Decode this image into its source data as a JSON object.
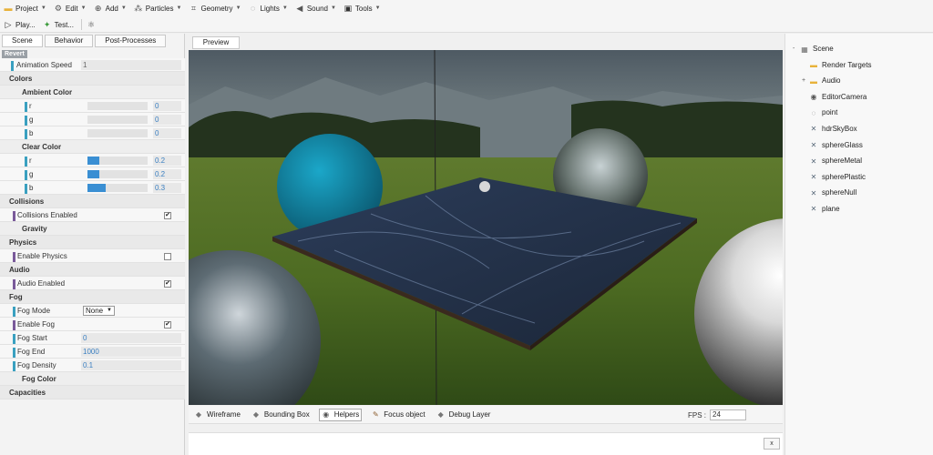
{
  "menu": {
    "row1": [
      {
        "name": "project",
        "label": "Project",
        "icon": "folder-icon",
        "caret": true
      },
      {
        "name": "edit",
        "label": "Edit",
        "icon": "gear-icon",
        "caret": true
      },
      {
        "name": "add",
        "label": "Add",
        "icon": "plus-circle-icon",
        "caret": true
      },
      {
        "name": "particles",
        "label": "Particles",
        "icon": "particles-icon",
        "caret": true
      },
      {
        "name": "geometry",
        "label": "Geometry",
        "icon": "geometry-icon",
        "caret": true
      },
      {
        "name": "lights",
        "label": "Lights",
        "icon": "bulb-icon",
        "caret": true
      },
      {
        "name": "sound",
        "label": "Sound",
        "icon": "speaker-icon",
        "caret": true
      },
      {
        "name": "tools",
        "label": "Tools",
        "icon": "clapper-icon",
        "caret": true
      }
    ],
    "row2": [
      {
        "name": "play",
        "label": "Play...",
        "icon": "play-icon"
      },
      {
        "name": "test",
        "label": "Test...",
        "icon": "wand-icon"
      },
      {
        "name": "logo",
        "label": "",
        "icon": "babylon-logo-icon"
      }
    ]
  },
  "left_tabs": [
    {
      "label": "Scene",
      "active": true
    },
    {
      "label": "Behavior",
      "active": false
    },
    {
      "label": "Post-Processes",
      "active": false
    }
  ],
  "props": {
    "revert": "Revert",
    "animation_speed": {
      "label": "Animation Speed",
      "value": "1"
    },
    "colors": "Colors",
    "ambient_color": "Ambient Color",
    "ambient": [
      {
        "label": "r",
        "value": "0",
        "fill": 0
      },
      {
        "label": "g",
        "value": "0",
        "fill": 0
      },
      {
        "label": "b",
        "value": "0",
        "fill": 0
      }
    ],
    "clear_color": "Clear Color",
    "clear": [
      {
        "label": "r",
        "value": "0.2",
        "fill": 0.2
      },
      {
        "label": "g",
        "value": "0.2",
        "fill": 0.2
      },
      {
        "label": "b",
        "value": "0.3",
        "fill": 0.3
      }
    ],
    "collisions": "Collisions",
    "collisions_enabled": "Collisions Enabled",
    "gravity": "Gravity",
    "physics": "Physics",
    "enable_physics": "Enable Physics",
    "audio": "Audio",
    "audio_enabled": "Audio Enabled",
    "fog": "Fog",
    "fog_mode": {
      "label": "Fog Mode",
      "value": "None"
    },
    "enable_fog": "Enable Fog",
    "fog_start": {
      "label": "Fog Start",
      "value": "0"
    },
    "fog_end": {
      "label": "Fog End",
      "value": "1000"
    },
    "fog_density": {
      "label": "Fog Density",
      "value": "0.1"
    },
    "fog_color": "Fog Color",
    "capacities": "Capacities"
  },
  "checks": {
    "collisions": true,
    "physics": false,
    "audio": true,
    "fog": true
  },
  "preview_tab": "Preview",
  "toolbar": [
    {
      "name": "wireframe",
      "label": "Wireframe",
      "icon": "cube-icon",
      "active": false
    },
    {
      "name": "bounding-box",
      "label": "Bounding Box",
      "icon": "cube-icon",
      "active": false
    },
    {
      "name": "helpers",
      "label": "Helpers",
      "icon": "eye-icon",
      "active": true
    },
    {
      "name": "focus-object",
      "label": "Focus object",
      "icon": "focus-icon",
      "active": false
    },
    {
      "name": "debug-layer",
      "label": "Debug Layer",
      "icon": "cube-icon",
      "active": false
    }
  ],
  "fps": {
    "label": "FPS :",
    "value": "24"
  },
  "close": "x",
  "tree": [
    {
      "label": "Scene",
      "icon": "scene-icon",
      "toggle": "-",
      "level": 0
    },
    {
      "label": "Render Targets",
      "icon": "folder-icon",
      "toggle": "",
      "level": 1
    },
    {
      "label": "Audio",
      "icon": "folder-icon",
      "toggle": "+",
      "level": 1
    },
    {
      "label": "EditorCamera",
      "icon": "camera-icon",
      "toggle": "",
      "level": 1
    },
    {
      "label": "point",
      "icon": "bulb-icon",
      "toggle": "",
      "level": 1
    },
    {
      "label": "hdrSkyBox",
      "icon": "mesh-icon",
      "toggle": "",
      "level": 1
    },
    {
      "label": "sphereGlass",
      "icon": "mesh-icon",
      "toggle": "",
      "level": 1
    },
    {
      "label": "sphereMetal",
      "icon": "mesh-icon",
      "toggle": "",
      "level": 1
    },
    {
      "label": "spherePlastic",
      "icon": "mesh-icon",
      "toggle": "",
      "level": 1
    },
    {
      "label": "sphereNull",
      "icon": "mesh-icon",
      "toggle": "",
      "level": 1
    },
    {
      "label": "plane",
      "icon": "mesh-icon",
      "toggle": "",
      "level": 1
    }
  ],
  "colors": {
    "accent_blue": "#3a8fd3",
    "section_bar_teal": "#3aa0c0",
    "section_bar_purple": "#7a5a9a"
  }
}
